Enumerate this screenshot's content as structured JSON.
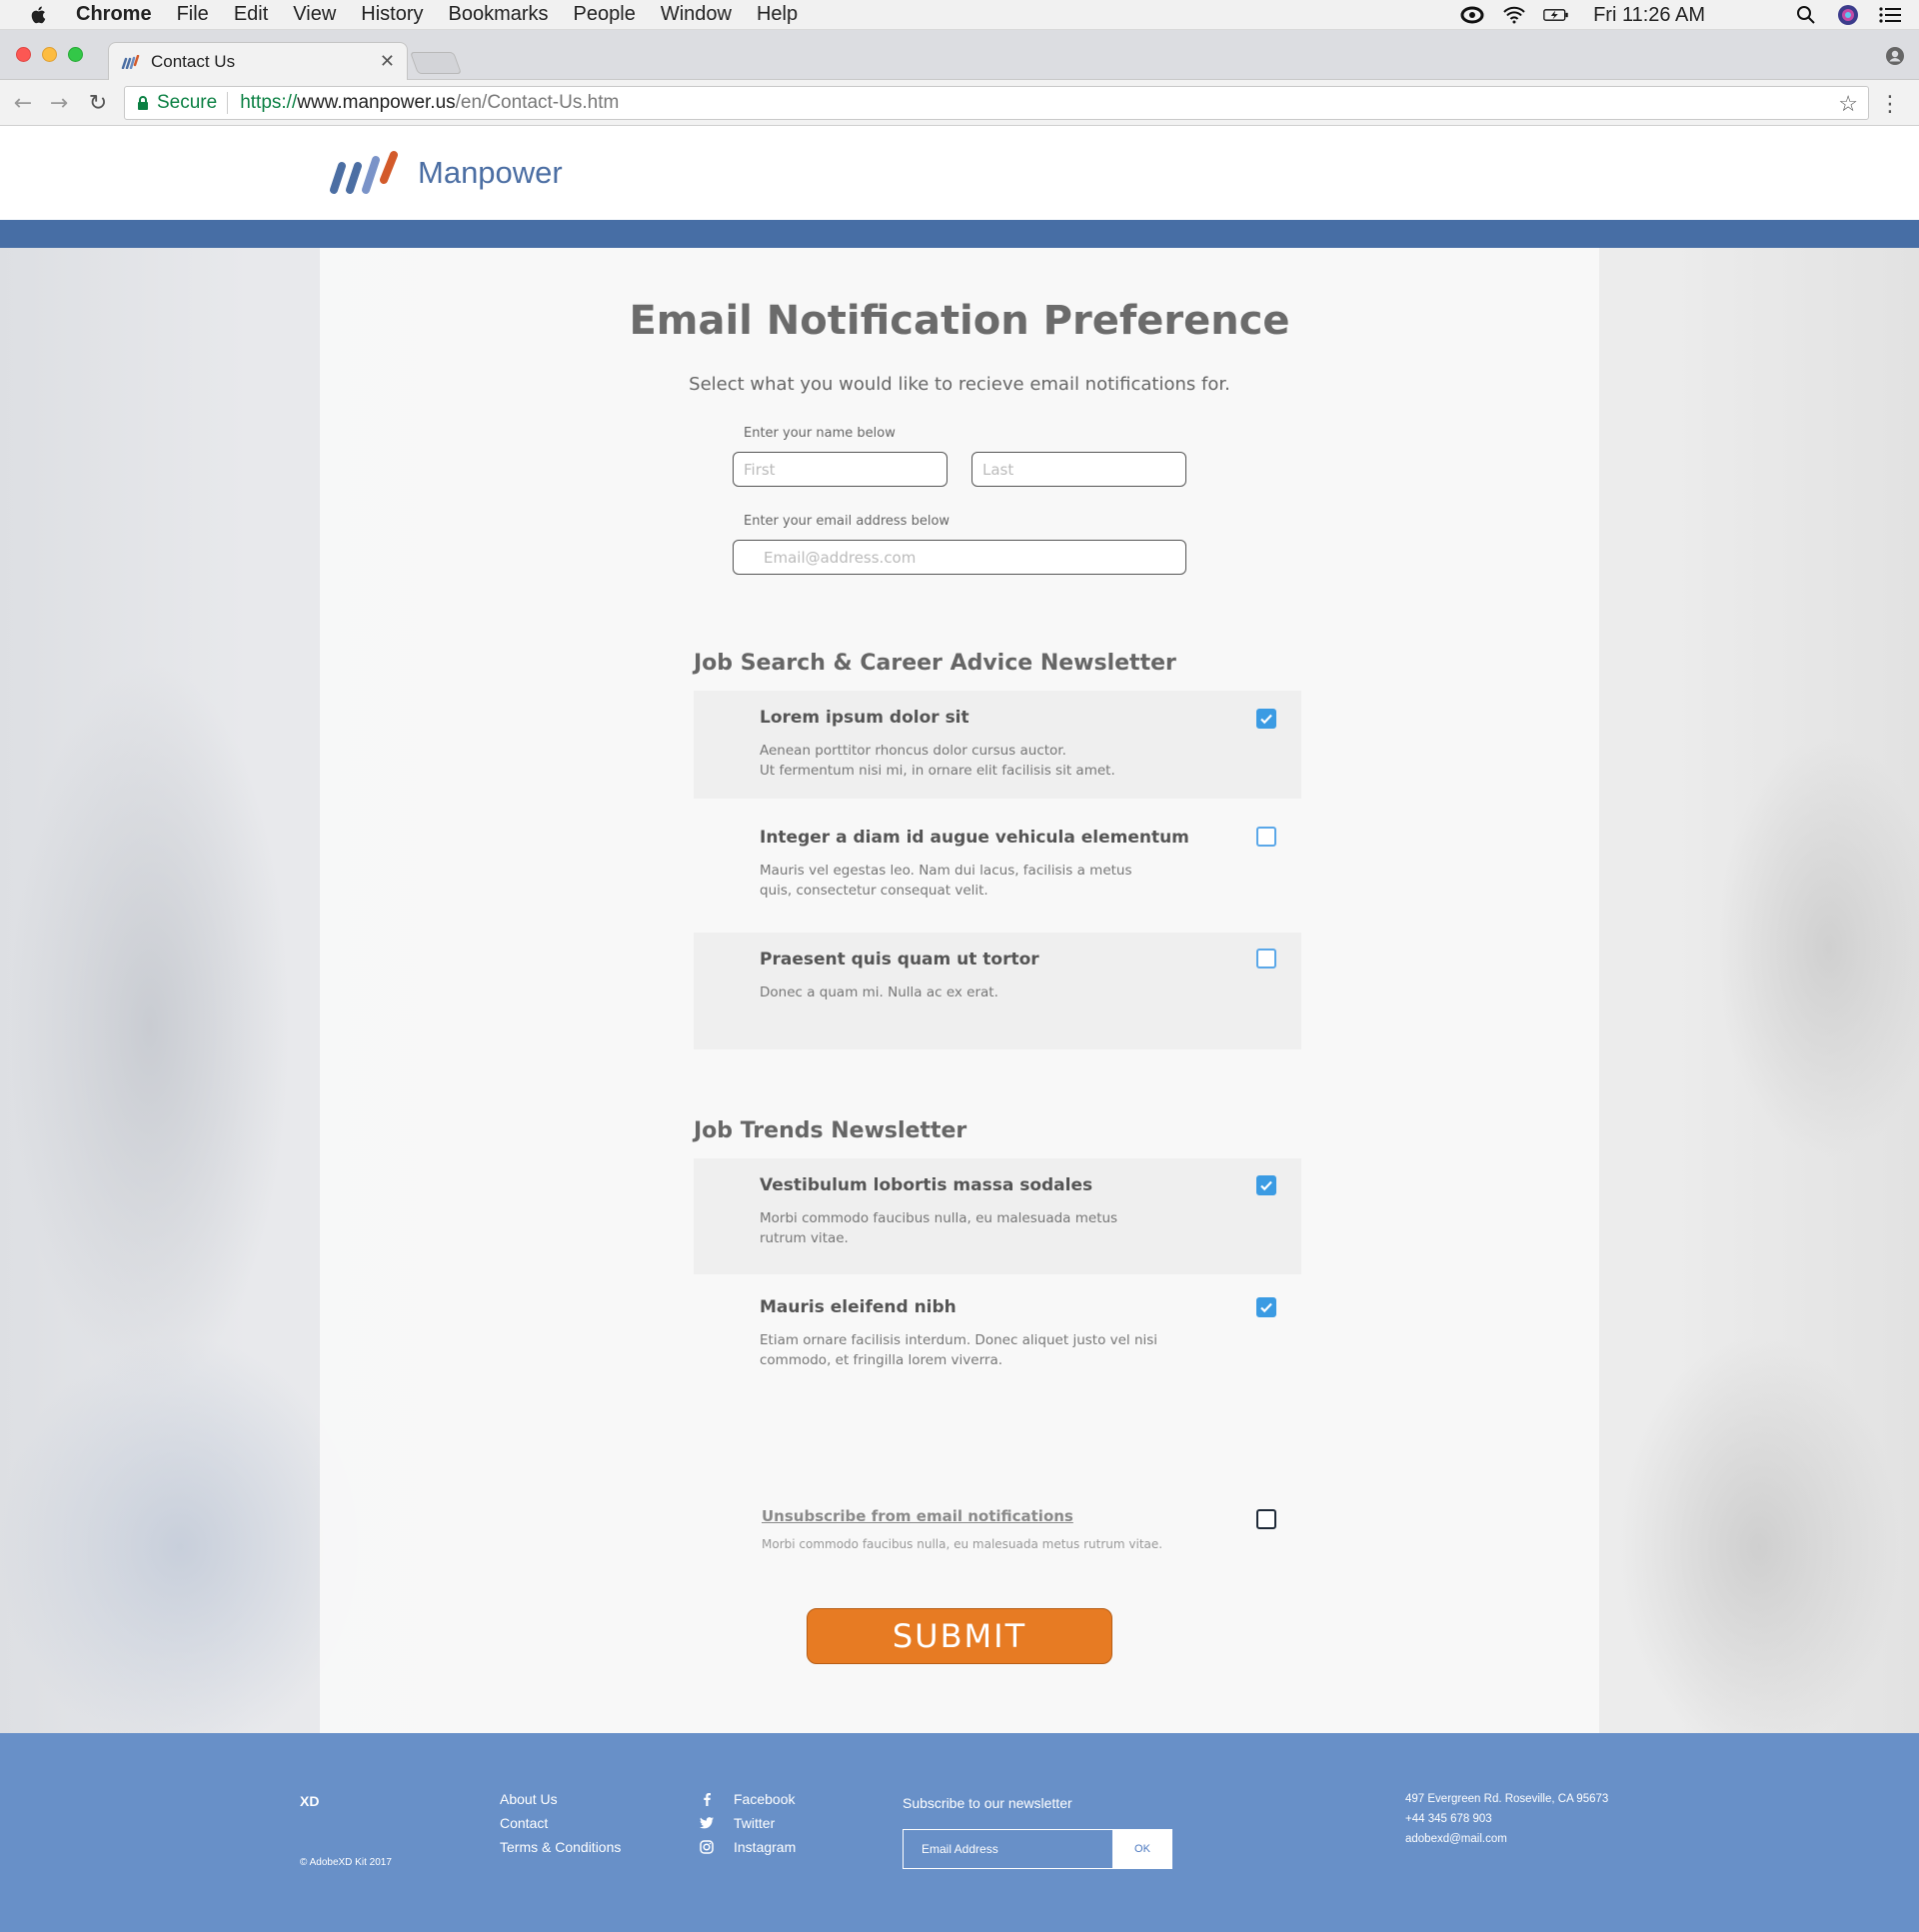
{
  "menubar": {
    "items": [
      "Chrome",
      "File",
      "Edit",
      "View",
      "History",
      "Bookmarks",
      "People",
      "Window",
      "Help"
    ],
    "clock": "Fri 11:26 AM",
    "status_icons": [
      "creative-cloud-icon",
      "wifi-icon",
      "battery-icon",
      "spotlight-icon",
      "siri-icon",
      "notification-center-icon"
    ]
  },
  "browser": {
    "tab_title": "Contact Us",
    "secure_label": "Secure",
    "url_protocol": "https://",
    "url_host": "www.manpower.us",
    "url_path": "/en/Contact-Us.htm"
  },
  "site": {
    "brand": "Manpower",
    "colors": {
      "header_bar": "#476ea5",
      "footer": "#6890c8",
      "submit": "#e77b23",
      "checkbox": "#3b9be3"
    }
  },
  "form": {
    "title": "Email Notification Preference",
    "subtitle": "Select what you would like to recieve email notifications for.",
    "name_label": "Enter your name below",
    "first_placeholder": "First",
    "last_placeholder": "Last",
    "email_label": "Enter your email address below",
    "email_placeholder": "Email@address.com"
  },
  "sections": [
    {
      "title": "Job Search & Career Advice Newsletter",
      "options": [
        {
          "title": "Lorem ipsum dolor sit",
          "desc1": "Aenean porttitor rhoncus dolor cursus auctor.",
          "desc2": "Ut fermentum nisi mi, in ornare elit facilisis sit amet.",
          "checked": true
        },
        {
          "title": "Integer a diam id augue vehicula elementum",
          "desc1": "Mauris vel egestas leo. Nam dui lacus, facilisis a metus",
          "desc2": "quis, consectetur consequat velit.",
          "checked": false
        },
        {
          "title": "Praesent quis quam ut tortor",
          "desc1": "Donec a quam mi. Nulla ac ex erat.",
          "desc2": "",
          "checked": false
        }
      ]
    },
    {
      "title": "Job Trends Newsletter",
      "options": [
        {
          "title": "Vestibulum lobortis massa sodales",
          "desc1": "Morbi commodo faucibus nulla, eu malesuada metus",
          "desc2": "rutrum vitae.",
          "checked": true
        },
        {
          "title": "Mauris eleifend nibh",
          "desc1": "Etiam ornare facilisis interdum. Donec aliquet justo vel nisi",
          "desc2": "commodo, et fringilla lorem viverra.",
          "checked": true
        }
      ]
    }
  ],
  "unsubscribe": {
    "label": "Unsubscribe from email notifications",
    "desc": "Morbi commodo faucibus nulla, eu malesuada metus rutrum vitae.",
    "checked": false
  },
  "submit_label": "SUBMIT",
  "footer": {
    "brand": "XD",
    "copyright": "© AdobeXD Kit 2017",
    "links": [
      "About Us",
      "Contact",
      "Terms & Conditions"
    ],
    "social": [
      "Facebook",
      "Twitter",
      "Instagram"
    ],
    "newsletter_title": "Subscribe to our newsletter",
    "email_placeholder": "Email Address",
    "ok_label": "OK",
    "address": [
      "497 Evergreen Rd. Roseville, CA 95673",
      "+44 345 678 903",
      "adobexd@mail.com"
    ]
  }
}
